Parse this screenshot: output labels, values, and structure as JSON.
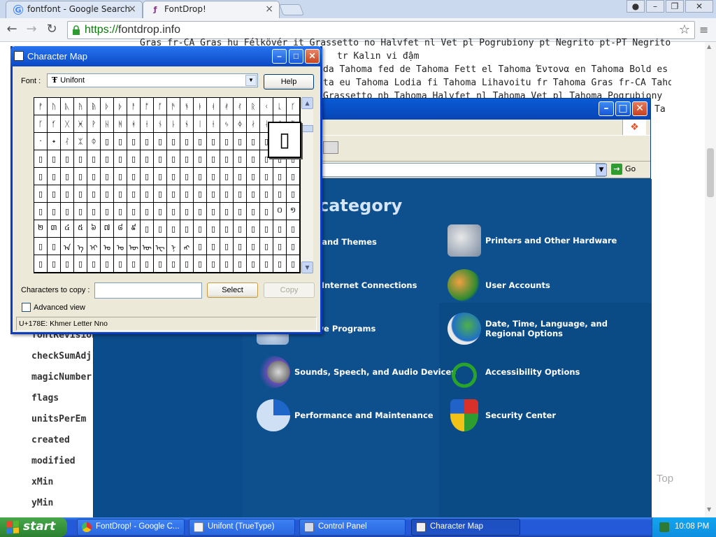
{
  "browser": {
    "tabs": [
      {
        "title": "fontfont - Google Search",
        "icon": "google-icon"
      },
      {
        "title": "FontDrop!",
        "icon": "fontdrop-icon"
      }
    ],
    "url_scheme": "https://",
    "url_host": "fontdrop.info",
    "page_lines": [
      "Gras fr-CA Gras hu Félkövér it Grassetto no Halvfet nl Vet pl Pogrubiony pt Negrito pt-PT Negrito ro No",
      "tr Kalın vi đậm",
      "da Tahoma fed de Tahoma Fett el Tahoma Έντονα en Tahoma Bold es",
      "ta eu Tahoma Lodia fi Tahoma Lihavoitu fr Tahoma Gras fr-CA Tahom",
      "Grassetto nb Tahoma Halvfet nl Tahoma Vet pl Tahoma Pogrubiony",
      "Ta"
    ],
    "fields": [
      "fontRevision",
      "checkSumAdj",
      "magicNumber",
      "flags",
      "unitsPerEm",
      "created",
      "modified",
      "xMin",
      "yMin"
    ],
    "top_button": "Top"
  },
  "control_panel": {
    "heading": "category",
    "go_label": "Go",
    "categories": [
      {
        "label": "rance and Themes",
        "icon": "appearance-icon"
      },
      {
        "label": "Printers and Other Hardware",
        "icon": "printer-icon"
      },
      {
        "label": "k and Internet Connections",
        "icon": "network-icon"
      },
      {
        "label": "User Accounts",
        "icon": "users-icon"
      },
      {
        "label": "Remove Programs",
        "icon": "programs-icon"
      },
      {
        "label": "Date, Time, Language, and Regional Options",
        "icon": "datetime-icon"
      },
      {
        "label": "Sounds, Speech, and Audio Devices",
        "icon": "sound-icon"
      },
      {
        "label": "Accessibility Options",
        "icon": "accessibility-icon"
      },
      {
        "label": "Performance and Maintenance",
        "icon": "performance-icon"
      },
      {
        "label": "Security Center",
        "icon": "shield-icon"
      }
    ]
  },
  "charmap": {
    "title": "Character Map",
    "font_label": "Font :",
    "font_value": "Unifont",
    "help_label": "Help",
    "chars_to_copy_label": "Characters to copy :",
    "chars_to_copy_value": "",
    "select_label": "Select",
    "copy_label": "Copy",
    "advanced_view_label": "Advanced view",
    "status": "U+178E: Khmer Letter Nno",
    "magnified_char": "▯",
    "grid_rows": [
      [
        "ᚡ",
        "ᚢ",
        "ᚣ",
        "ᚤ",
        "ᚥ",
        "ᚦ",
        "ᚧ",
        "ᚨ",
        "ᚩ",
        "ᚪ",
        "ᚫ",
        "ᚬ",
        "ᚭ",
        "ᚮ",
        "ᚯ",
        "ᚰ",
        "ᚱ",
        "ᚲ",
        "ᚳ",
        "ᚴ"
      ],
      [
        "ᚵ",
        "ᚶ",
        "ᚷ",
        "ᚸ",
        "ᚹ",
        "ᚺ",
        "ᚻ",
        "ᚼ",
        "ᚽ",
        "ᚾ",
        "ᚿ",
        "ᛀ",
        "ᛁ",
        "ᛂ",
        "ᛃ",
        "ᛄ",
        "ᛅ",
        "ᛆ",
        "ᛇ",
        "ᛈ"
      ],
      [
        "᛫",
        "᛭",
        "ᛮ",
        "ᛯ",
        "ᛰ",
        "▯",
        "▯",
        "▯",
        "▯",
        "▯",
        "▯",
        "▯",
        "▯",
        "▯",
        "▯",
        "▯",
        "▯",
        "▯",
        "▯",
        "▯"
      ],
      [
        "▯",
        "▯",
        "▯",
        "▯",
        "▯",
        "▯",
        "▯",
        "▯",
        "▯",
        "▯",
        "▯",
        "▯",
        "▯",
        "▯",
        "▯",
        "▯",
        "▯",
        "▯",
        "▯",
        "▯"
      ],
      [
        "▯",
        "▯",
        "▯",
        "▯",
        "▯",
        "▯",
        "▯",
        "▯",
        "▯",
        "▯",
        "▯",
        "▯",
        "▯",
        "▯",
        "▯",
        "▯",
        "▯",
        "▯",
        "▯",
        "▯"
      ],
      [
        "▯",
        "▯",
        "▯",
        "▯",
        "▯",
        "▯",
        "▯",
        "▯",
        "▯",
        "▯",
        "▯",
        "▯",
        "▯",
        "▯",
        "▯",
        "▯",
        "▯",
        "▯",
        "▯",
        "▯"
      ],
      [
        "▯",
        "▯",
        "▯",
        "▯",
        "▯",
        "▯",
        "▯",
        "▯",
        "▯",
        "▯",
        "▯",
        "▯",
        "▯",
        "▯",
        "▯",
        "▯",
        "▯",
        "▯",
        "០",
        "១"
      ],
      [
        "២",
        "៣",
        "៤",
        "៥",
        "៦",
        "៧",
        "៨",
        "៩",
        "▯",
        "▯",
        "▯",
        "▯",
        "▯",
        "▯",
        "▯",
        "▯",
        "▯",
        "▯",
        "▯",
        "▯"
      ],
      [
        "▯",
        "▯",
        "ᠠ",
        "ᠡ",
        "ᠢ",
        "ᠣ",
        "ᠤ",
        "ᠥ",
        "ᠦ",
        "ᠧ",
        "ᠨ",
        "ᠩ",
        "▯",
        "▯",
        "▯",
        "▯",
        "▯",
        "▯",
        "▯",
        "▯"
      ],
      [
        "▯",
        "▯",
        "▯",
        "▯",
        "▯",
        "▯",
        "▯",
        "▯",
        "▯",
        "▯",
        "▯",
        "▯",
        "▯",
        "▯",
        "▯",
        "▯",
        "▯",
        "▯",
        "▯",
        "▯"
      ]
    ]
  },
  "taskbar": {
    "start_label": "start",
    "items": [
      {
        "label": "FontDrop! - Google C...",
        "icon": "chrome-icon"
      },
      {
        "label": "Unifont (TrueType)",
        "icon": "font-file-icon"
      },
      {
        "label": "Control Panel",
        "icon": "control-panel-icon"
      },
      {
        "label": "Character Map",
        "icon": "charmap-icon"
      }
    ],
    "clock": "10:08 PM"
  },
  "colors": {
    "xp_blue": "#0a5bd6",
    "control_panel_bg": "#0b4c8c",
    "start_green": "#35913a",
    "url_green": "#0a7a0a"
  }
}
